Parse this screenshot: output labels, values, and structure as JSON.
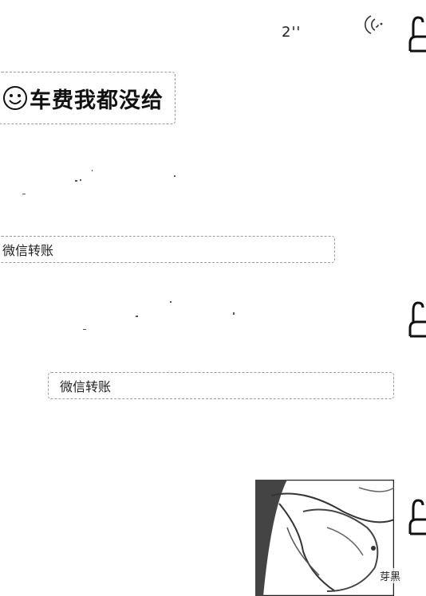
{
  "voice_message": {
    "duration": "2''"
  },
  "messages": [
    {
      "text": "车费我都没给",
      "emoji": "smile-emoji"
    },
    {
      "text": "微信转账"
    },
    {
      "text": "微信转账"
    }
  ],
  "watermark": "芽黑",
  "icons": [
    "voice-wave-icon",
    "avatar-icon",
    "smile-emoji"
  ]
}
